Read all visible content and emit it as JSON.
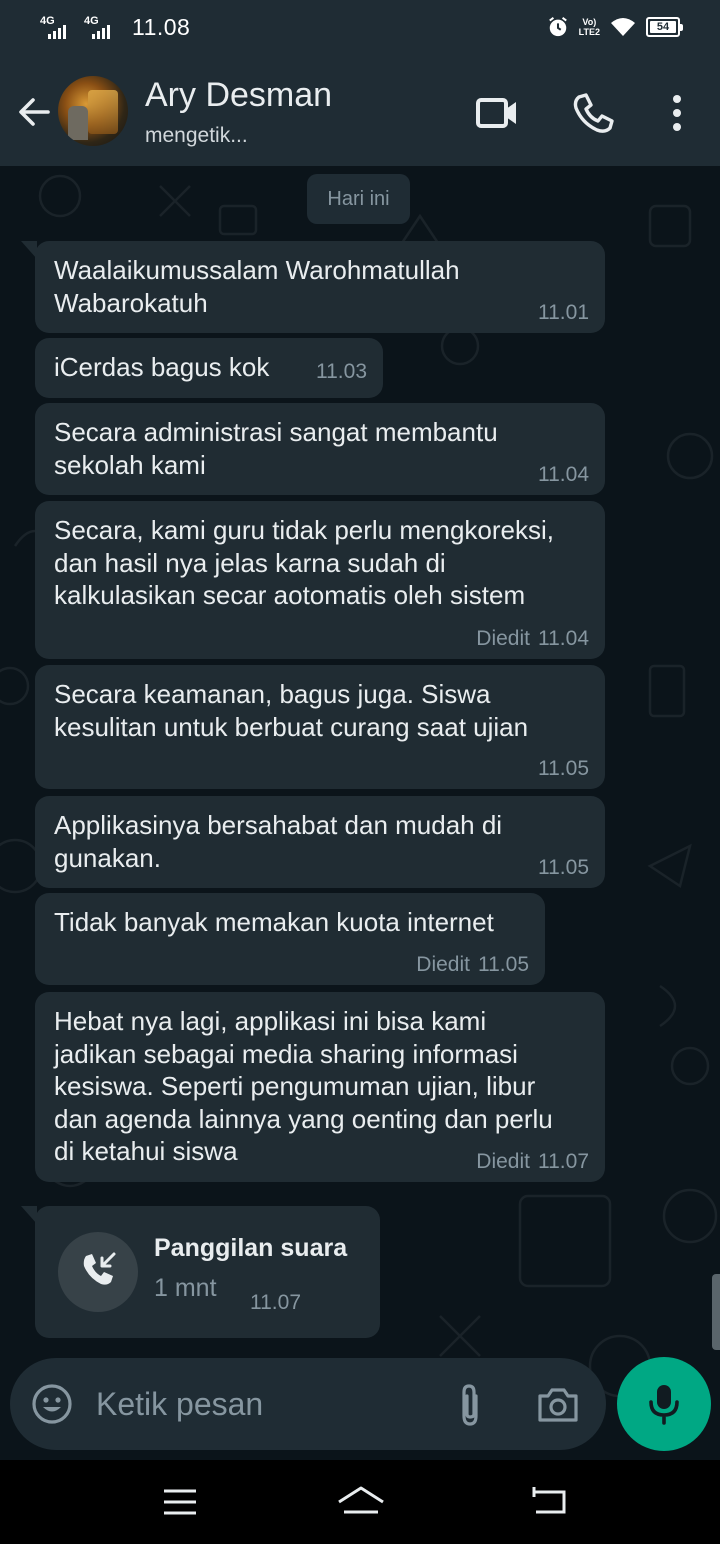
{
  "status_bar": {
    "signal_1": "4G",
    "signal_2": "4G",
    "time": "11.08",
    "volte_line1": "Vo)",
    "volte_line2": "LTE2",
    "battery": "54"
  },
  "header": {
    "contact_name": "Ary Desman",
    "status": "mengetik...",
    "icons": [
      "back-arrow-icon",
      "video-call-icon",
      "voice-call-icon",
      "more-options-icon"
    ]
  },
  "chat": {
    "date_divider": "Hari ini",
    "messages": [
      {
        "text": "Waalaikumussalam Warohmatullah\nWabarokatuh",
        "time": "11.01",
        "edited": ""
      },
      {
        "text": "iCerdas bagus kok",
        "time": "11.03",
        "edited": ""
      },
      {
        "text": "Secara administrasi sangat membantu\nsekolah kami",
        "time": "11.04",
        "edited": ""
      },
      {
        "text": "Secara, kami guru tidak perlu mengkoreksi,\ndan hasil nya jelas karna sudah di\nkalkulasikan secar aotomatis oleh sistem",
        "time": "11.04",
        "edited": "Diedit"
      },
      {
        "text": "Secara keamanan, bagus juga. Siswa\nkesulitan untuk berbuat curang saat ujian",
        "time": "11.05",
        "edited": ""
      },
      {
        "text": "Applikasinya bersahabat dan mudah di\ngunakan.",
        "time": "11.05",
        "edited": ""
      },
      {
        "text": "Tidak banyak memakan kuota internet",
        "time": "11.05",
        "edited": "Diedit"
      },
      {
        "text": "Hebat nya lagi, applikasi ini bisa kami\njadikan sebagai media sharing informasi\nkesiswa. Seperti pengumuman ujian, libur\ndan agenda lainnya yang oenting dan perlu\ndi ketahui siswa",
        "time": "11.07",
        "edited": "Diedit"
      }
    ],
    "call": {
      "title": "Panggilan suara",
      "duration": "1 mnt",
      "time": "11.07",
      "icon": "incoming-call-icon"
    }
  },
  "composer": {
    "placeholder": "Ketik pesan",
    "icons": [
      "emoji-icon",
      "attachment-icon",
      "camera-icon",
      "microphone-icon"
    ]
  },
  "nav_bar": {
    "icons": [
      "menu-icon",
      "home-icon",
      "back-icon"
    ]
  },
  "colors": {
    "background": "#0b141a",
    "header": "#1f2c34",
    "bubble": "#202c33",
    "accent": "#00a884",
    "secondary_text": "#8696a0"
  }
}
